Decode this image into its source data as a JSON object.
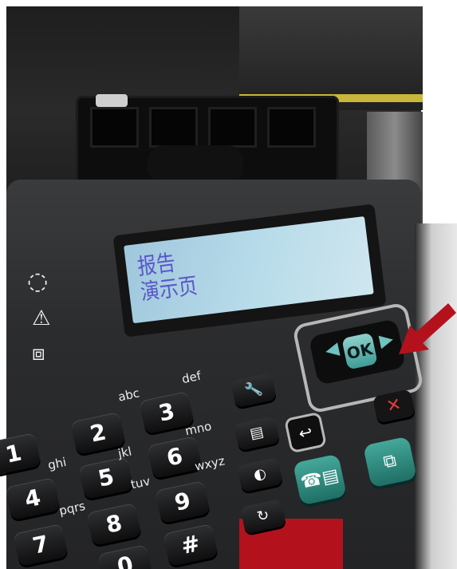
{
  "lcd": {
    "line1": "报告",
    "line2": "演示页"
  },
  "status_icons": [
    {
      "name": "power-icon",
      "glyph": "◌"
    },
    {
      "name": "warning-icon",
      "glyph": "⚠"
    },
    {
      "name": "toner-icon",
      "glyph": "⧈"
    }
  ],
  "keypad": {
    "keys": [
      "1",
      "2",
      "3",
      "4",
      "5",
      "6",
      "7",
      "8",
      "9",
      "0",
      "#"
    ],
    "letters": [
      "abc",
      "def",
      "ghi",
      "jkl",
      "mno",
      "pqrs",
      "tuv",
      "wxyz"
    ]
  },
  "nav": {
    "ok_label": "OK",
    "left_arrow": "◀",
    "right_arrow": "▶",
    "back_glyph": "↩",
    "cancel_glyph": "✕"
  },
  "function_keys": [
    {
      "name": "setup-key",
      "glyph": "🔧"
    },
    {
      "name": "copy-key",
      "glyph": "▤"
    },
    {
      "name": "contrast-key",
      "glyph": "◐"
    },
    {
      "name": "redial-key",
      "glyph": "↻"
    }
  ],
  "teal_keys": [
    {
      "name": "fax-key",
      "glyph": "☎▤"
    },
    {
      "name": "copy-start-key",
      "glyph": "⧉"
    }
  ],
  "colors": {
    "panel": "#2b2c2e",
    "lcd": "#b8dcea",
    "lcd_text": "#5a56c8",
    "accent_teal": "#44a89a",
    "arrow_red": "#b3121d"
  }
}
